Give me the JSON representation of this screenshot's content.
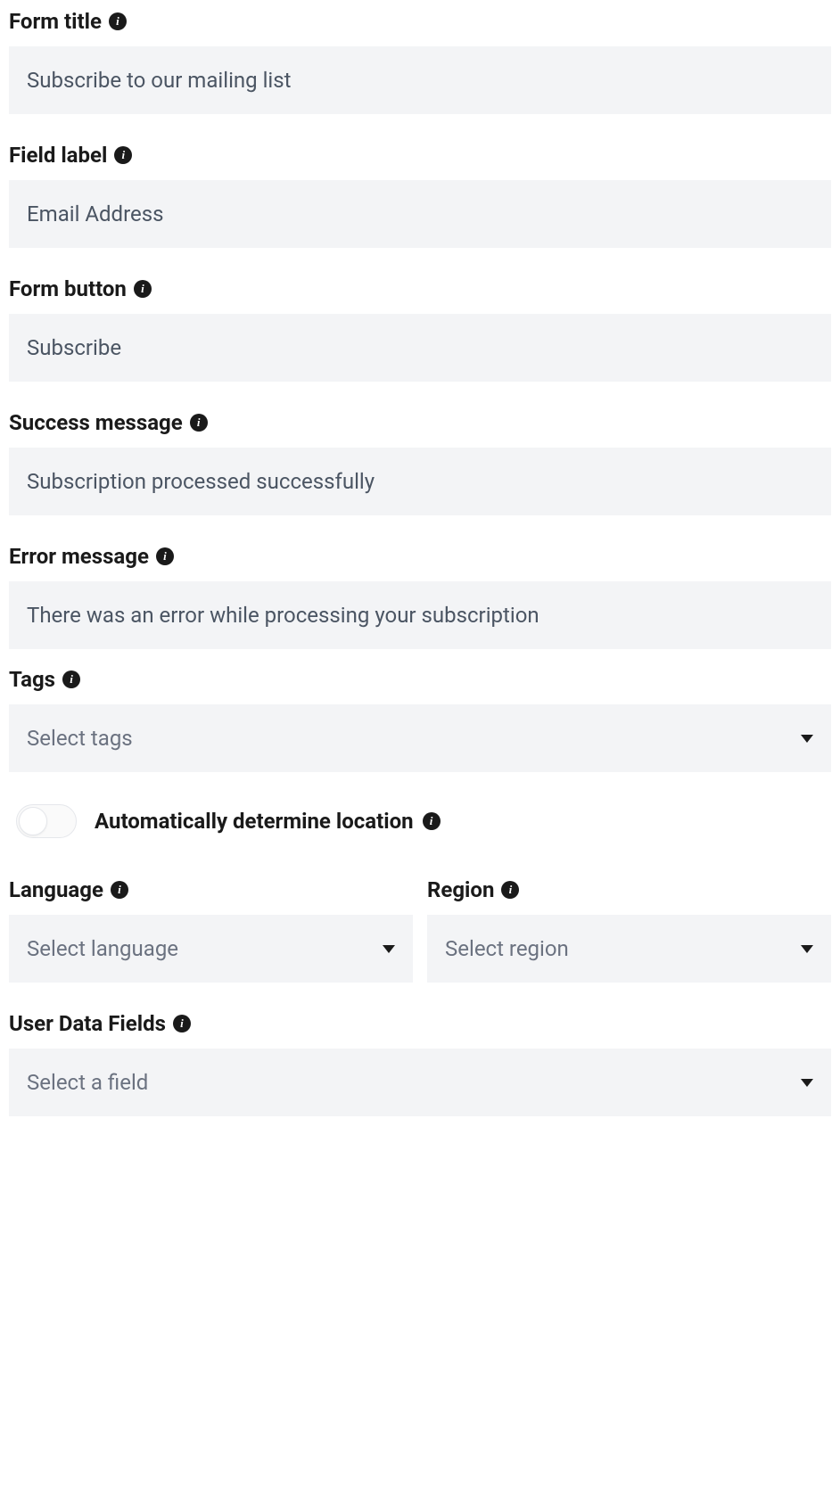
{
  "fields": {
    "form_title": {
      "label": "Form title",
      "value": "Subscribe to our mailing list"
    },
    "field_label": {
      "label": "Field label",
      "value": "Email Address"
    },
    "form_button": {
      "label": "Form button",
      "value": "Subscribe"
    },
    "success_message": {
      "label": "Success message",
      "value": "Subscription processed successfully"
    },
    "error_message": {
      "label": "Error message",
      "value": "There was an error while processing your subscription"
    },
    "tags": {
      "label": "Tags",
      "placeholder": "Select tags"
    },
    "auto_location": {
      "label": "Automatically determine location",
      "enabled": false
    },
    "language": {
      "label": "Language",
      "placeholder": "Select language"
    },
    "region": {
      "label": "Region",
      "placeholder": "Select region"
    },
    "user_data_fields": {
      "label": "User Data Fields",
      "placeholder": "Select a field"
    }
  }
}
